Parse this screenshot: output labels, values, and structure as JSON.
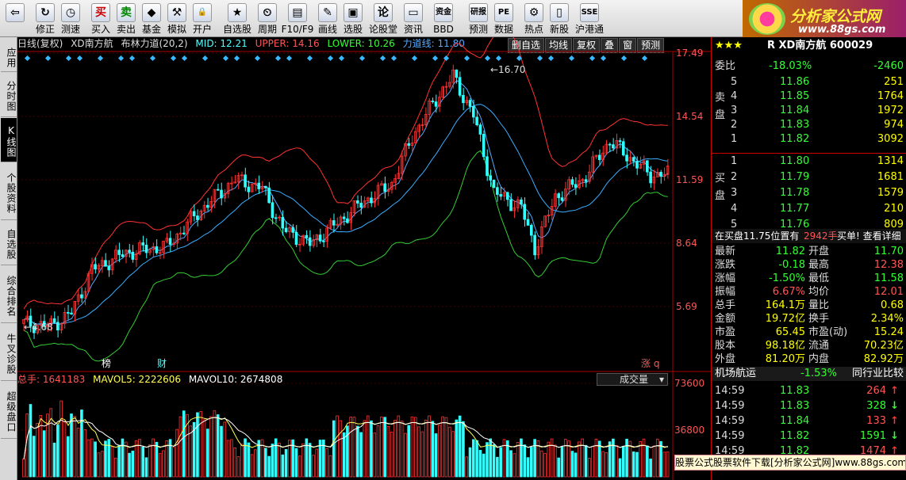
{
  "toolbar": {
    "items": [
      {
        "name": "back-button",
        "label": "",
        "icon": "⇦"
      },
      {
        "name": "modify-button",
        "label": "修正",
        "icon": "↻"
      },
      {
        "name": "test-button",
        "label": "测速",
        "icon": "◷"
      },
      {
        "name": "buy-button",
        "label": "买入",
        "icon": "买"
      },
      {
        "name": "sell-button",
        "label": "卖出",
        "icon": "卖"
      },
      {
        "name": "fund-button",
        "label": "基金",
        "icon": "◆"
      },
      {
        "name": "simulate-button",
        "label": "模拟",
        "icon": "⚒"
      },
      {
        "name": "open-account-button",
        "label": "开户",
        "icon": "🔒"
      },
      {
        "name": "selfselect-button",
        "label": "自选股",
        "icon": "★"
      },
      {
        "name": "period-button",
        "label": "周期",
        "icon": "⏲"
      },
      {
        "name": "f10-button",
        "label": "F10/F9",
        "icon": "▤"
      },
      {
        "name": "draw-button",
        "label": "画线",
        "icon": "✎"
      },
      {
        "name": "stockselect-button",
        "label": "选股",
        "icon": "▣"
      },
      {
        "name": "forum-button",
        "label": "论股堂",
        "icon": "论"
      },
      {
        "name": "info-button",
        "label": "资讯",
        "icon": "▭"
      },
      {
        "name": "bbd-button",
        "label": "BBD",
        "icon": "资金"
      },
      {
        "name": "research-button",
        "label": "预测",
        "icon": "研报"
      },
      {
        "name": "data-button",
        "label": "数据",
        "icon": "PE"
      },
      {
        "name": "hot-button",
        "label": "热点",
        "icon": "⚙"
      },
      {
        "name": "newstock-button",
        "label": "新股",
        "icon": "▯"
      },
      {
        "name": "hk-button",
        "label": "沪港通",
        "icon": "SSE"
      }
    ],
    "logo_title": "分析家公式网",
    "logo_url": "www.88gs.com"
  },
  "sidebar": {
    "tabs": [
      "应用",
      "分时图",
      "K线图",
      "个股资料",
      "自选股",
      "综合排名",
      "牛叉诊股",
      "超级盘口"
    ],
    "active": "K线图"
  },
  "price_header": {
    "mode": "日线(复权)",
    "stock": "XD南方航",
    "indicator": "布林力道(20,2)",
    "mid": "MID: 12.21",
    "upper": "UPPER: 14.16",
    "lower": "LOWER: 10.26",
    "force": "力道线: 11.80"
  },
  "chart_buttons": [
    "删自选",
    "均线",
    "复权",
    "叠",
    "窗",
    "预测"
  ],
  "colors": {
    "up": "#ff3333",
    "down": "#33ffff",
    "mid_line": "#3aaeff",
    "upper_line": "#ff3333",
    "lower_line": "#33cc33",
    "force_line": "#55aaff",
    "label_yellow": "#ffff55",
    "label_red": "#ff5555",
    "label_cyan": "#55ffff",
    "label_green": "#33ff33"
  },
  "chart_data": {
    "type": "candlestick",
    "y_ticks": [
      "17.49",
      "14.54",
      "11.59",
      "8.64",
      "5.69"
    ],
    "volume_ticks": [
      "73600",
      "36800"
    ],
    "annotations": {
      "high": "16.70",
      "low": "4.68",
      "markers": [
        "榜",
        "财"
      ],
      "right_marker": "涨 q"
    }
  },
  "volume_header": {
    "total": "总手: 1641183",
    "mavol5": "MAVOL5: 2222606",
    "mavol10": "MAVOL10: 2674808",
    "select": "成交量"
  },
  "right_panel": {
    "title": "R XD南方航 600029",
    "weibi_label": "委比",
    "weibi_pct": "-18.03%",
    "weibi_val": "-2460",
    "sell_label": "卖盘",
    "buy_label": "买盘",
    "sell": [
      [
        "5",
        "11.86",
        "251"
      ],
      [
        "4",
        "11.85",
        "1764"
      ],
      [
        "3",
        "11.84",
        "1972"
      ],
      [
        "2",
        "11.83",
        "974"
      ],
      [
        "1",
        "11.82",
        "3092"
      ]
    ],
    "buy": [
      [
        "1",
        "11.80",
        "1314"
      ],
      [
        "2",
        "11.79",
        "1681"
      ],
      [
        "3",
        "11.78",
        "1579"
      ],
      [
        "4",
        "11.77",
        "210"
      ],
      [
        "5",
        "11.76",
        "809"
      ]
    ],
    "notice_a": "在买盘11.75位置有",
    "notice_b": "2942手",
    "notice_c": "买单! 查看详细",
    "stats": [
      [
        "最新",
        "11.82",
        "开盘",
        "11.70"
      ],
      [
        "涨跌",
        "-0.18",
        "最高",
        "12.38"
      ],
      [
        "涨幅",
        "-1.50%",
        "最低",
        "11.58"
      ],
      [
        "振幅",
        "6.67%",
        "均价",
        "12.01"
      ],
      [
        "总手",
        "164.1万",
        "量比",
        "0.68"
      ],
      [
        "金额",
        "19.72亿",
        "换手",
        "2.34%"
      ],
      [
        "市盈",
        "65.45",
        "市盈(动)",
        "15.24"
      ],
      [
        "股本",
        "98.18亿",
        "流通",
        "70.23亿"
      ],
      [
        "外盘",
        "81.20万",
        "内盘",
        "82.92万"
      ]
    ],
    "sector": "机场航运",
    "sector_pct": "-1.53%",
    "sector_compare": "同行业比较",
    "ticks": [
      [
        "14:59",
        "11.83",
        "264",
        "↑"
      ],
      [
        "14:59",
        "11.83",
        "328",
        "↓"
      ],
      [
        "14:59",
        "11.84",
        "133",
        "↑"
      ],
      [
        "14:59",
        "11.82",
        "1591",
        "↓"
      ],
      [
        "14:59",
        "11.82",
        "1474",
        "↑"
      ]
    ]
  },
  "ad": "股票公式股票软件下载[分析家公式网]www.88gs.com"
}
